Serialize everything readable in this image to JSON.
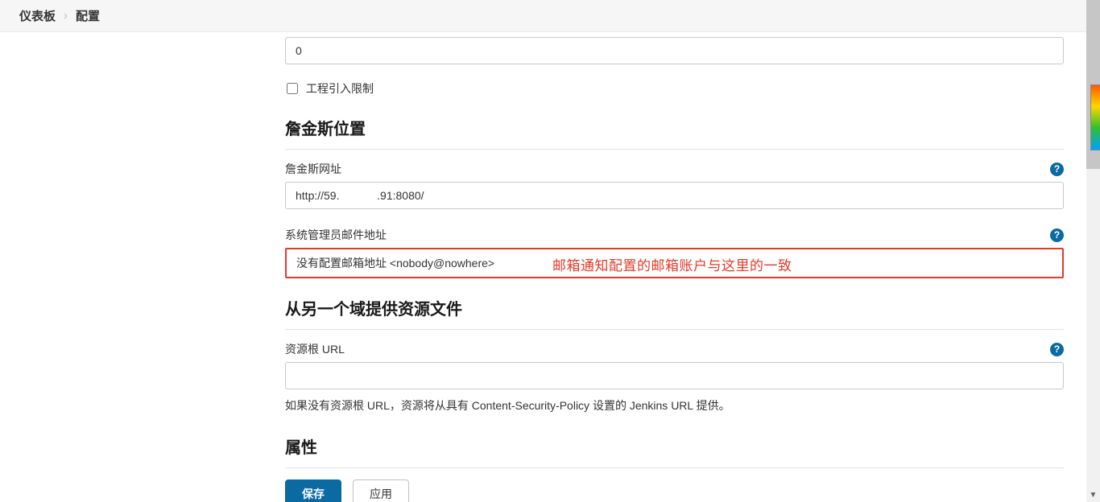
{
  "breadcrumb": {
    "item1": "仪表板",
    "item2": "配置",
    "separator": "›"
  },
  "section_retry": {
    "label_fragment": "",
    "input_value": "0",
    "checkbox_label": "工程引入限制"
  },
  "section_location": {
    "title": "詹金斯位置",
    "url_label": "詹金斯网址",
    "url_value": "http://59.            .91:8080/",
    "admin_label": "系统管理员邮件地址",
    "admin_value": "没有配置邮箱地址 <nobody@nowhere>",
    "annotation": "邮箱通知配置的邮箱账户与这里的一致"
  },
  "section_resource": {
    "title": "从另一个域提供资源文件",
    "url_label": "资源根 URL",
    "url_value": "",
    "helper": "如果没有资源根 URL，资源将从具有 Content-Security-Policy 设置的 Jenkins URL 提供。"
  },
  "section_attrs": {
    "title": "属性"
  },
  "buttons": {
    "save": "保存",
    "apply": "应用"
  },
  "help_glyph": "?"
}
